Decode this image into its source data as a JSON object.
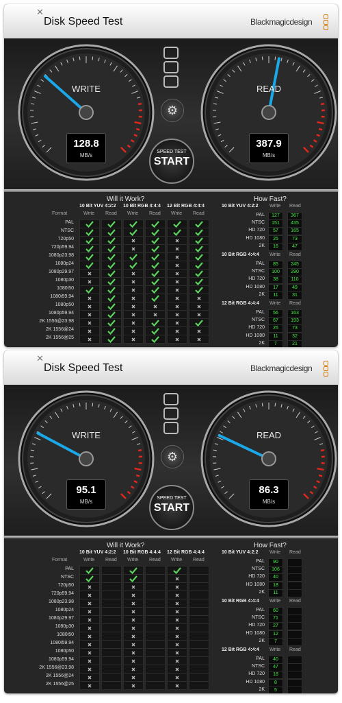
{
  "windows": [
    {
      "app_title": "Disk Speed Test",
      "brand": "Blackmagicdesign",
      "close_icon": "close-x-icon",
      "write": {
        "label": "WRITE",
        "value": "128.8",
        "unit": "MB/s",
        "needle_fraction": 0.32
      },
      "read": {
        "label": "READ",
        "value": "387.9",
        "unit": "MB/s",
        "needle_fraction": 0.54
      },
      "start": {
        "small": "SPEED TEST",
        "big": "START"
      },
      "will_title": "Will it Work?",
      "fast_title": "How Fast?",
      "groups": [
        "10 Bit YUV 4:2:2",
        "10 Bit RGB 4:4:4",
        "12 Bit RGB 4:4:4"
      ],
      "col_write": "Write",
      "col_read": "Read",
      "format_header": "Format",
      "formats": [
        "PAL",
        "NTSC",
        "720p50",
        "720p59.94",
        "1080p23.98",
        "1080p24",
        "1080p29.97",
        "1080p30",
        "1080i50",
        "1080i59.94",
        "1080p50",
        "1080p59.94",
        "2K 1556@23.98",
        "2K 1556@24",
        "2K 1556@25"
      ],
      "grid": [
        [
          "ok",
          "ok",
          "ok",
          "ok",
          "ok",
          "ok"
        ],
        [
          "ok",
          "ok",
          "ok",
          "ok",
          "ok",
          "ok"
        ],
        [
          "ok",
          "ok",
          "x",
          "ok",
          "x",
          "ok"
        ],
        [
          "ok",
          "ok",
          "x",
          "ok",
          "x",
          "ok"
        ],
        [
          "ok",
          "ok",
          "ok",
          "ok",
          "x",
          "ok"
        ],
        [
          "ok",
          "ok",
          "ok",
          "ok",
          "x",
          "ok"
        ],
        [
          "x",
          "ok",
          "x",
          "ok",
          "x",
          "ok"
        ],
        [
          "x",
          "ok",
          "x",
          "ok",
          "x",
          "ok"
        ],
        [
          "ok",
          "ok",
          "x",
          "ok",
          "x",
          "ok"
        ],
        [
          "x",
          "ok",
          "x",
          "ok",
          "x",
          "x"
        ],
        [
          "x",
          "ok",
          "x",
          "x",
          "x",
          "x"
        ],
        [
          "x",
          "ok",
          "x",
          "x",
          "x",
          "x"
        ],
        [
          "x",
          "ok",
          "x",
          "ok",
          "x",
          "ok"
        ],
        [
          "x",
          "ok",
          "x",
          "ok",
          "x",
          "x"
        ],
        [
          "x",
          "ok",
          "x",
          "ok",
          "x",
          "x"
        ]
      ],
      "fast": [
        {
          "name": "10 Bit YUV 4:2:2",
          "rows": [
            [
              "PAL",
              "127",
              "367"
            ],
            [
              "NTSC",
              "151",
              "435"
            ],
            [
              "HD 720",
              "57",
              "165"
            ],
            [
              "HD 1080",
              "25",
              "73"
            ],
            [
              "2K",
              "16",
              "47"
            ]
          ]
        },
        {
          "name": "10 Bit RGB 4:4:4",
          "rows": [
            [
              "PAL",
              "85",
              "245"
            ],
            [
              "NTSC",
              "100",
              "290"
            ],
            [
              "HD 720",
              "38",
              "110"
            ],
            [
              "HD 1080",
              "17",
              "49"
            ],
            [
              "2K",
              "11",
              "31"
            ]
          ]
        },
        {
          "name": "12 Bit RGB 4:4:4",
          "rows": [
            [
              "PAL",
              "56",
              "163"
            ],
            [
              "NTSC",
              "67",
              "193"
            ],
            [
              "HD 720",
              "25",
              "73"
            ],
            [
              "HD 1080",
              "11",
              "32"
            ],
            [
              "2K",
              "7",
              "21"
            ]
          ]
        }
      ]
    },
    {
      "app_title": "Disk Speed Test",
      "brand": "Blackmagicdesign",
      "close_icon": "close-x-icon",
      "write": {
        "label": "WRITE",
        "value": "95.1",
        "unit": "MB/s",
        "needle_fraction": 0.27
      },
      "read": {
        "label": "READ",
        "value": "86.3",
        "unit": "MB/s",
        "needle_fraction": 0.26
      },
      "start": {
        "small": "SPEED TEST",
        "big": "START"
      },
      "will_title": "Will it Work?",
      "fast_title": "How Fast?",
      "groups": [
        "10 Bit YUV 4:2:2",
        "10 Bit RGB 4:4:4",
        "12 Bit RGB 4:4:4"
      ],
      "col_write": "Write",
      "col_read": "Read",
      "format_header": "Format",
      "formats": [
        "PAL",
        "NTSC",
        "720p50",
        "720p59.94",
        "1080p23.98",
        "1080p24",
        "1080p29.97",
        "1080p30",
        "1080i50",
        "1080i59.94",
        "1080p50",
        "1080p59.94",
        "2K 1556@23.98",
        "2K 1556@24",
        "2K 1556@25"
      ],
      "grid": [
        [
          "ok",
          "",
          "ok",
          "",
          "ok",
          ""
        ],
        [
          "ok",
          "",
          "ok",
          "",
          "x",
          ""
        ],
        [
          "x",
          "",
          "x",
          "",
          "x",
          ""
        ],
        [
          "x",
          "",
          "x",
          "",
          "x",
          ""
        ],
        [
          "x",
          "",
          "x",
          "",
          "x",
          ""
        ],
        [
          "x",
          "",
          "x",
          "",
          "x",
          ""
        ],
        [
          "x",
          "",
          "x",
          "",
          "x",
          ""
        ],
        [
          "x",
          "",
          "x",
          "",
          "x",
          ""
        ],
        [
          "x",
          "",
          "x",
          "",
          "x",
          ""
        ],
        [
          "x",
          "",
          "x",
          "",
          "x",
          ""
        ],
        [
          "x",
          "",
          "x",
          "",
          "x",
          ""
        ],
        [
          "x",
          "",
          "x",
          "",
          "x",
          ""
        ],
        [
          "x",
          "",
          "x",
          "",
          "x",
          ""
        ],
        [
          "x",
          "",
          "x",
          "",
          "x",
          ""
        ],
        [
          "x",
          "",
          "x",
          "",
          "x",
          ""
        ]
      ],
      "fast": [
        {
          "name": "10 Bit YUV 4:2:2",
          "rows": [
            [
              "PAL",
              "90",
              ""
            ],
            [
              "NTSC",
              "106",
              ""
            ],
            [
              "HD 720",
              "40",
              ""
            ],
            [
              "HD 1080",
              "18",
              ""
            ],
            [
              "2K",
              "11",
              ""
            ]
          ]
        },
        {
          "name": "10 Bit RGB 4:4:4",
          "rows": [
            [
              "PAL",
              "60",
              ""
            ],
            [
              "NTSC",
              "71",
              ""
            ],
            [
              "HD 720",
              "27",
              ""
            ],
            [
              "HD 1080",
              "12",
              ""
            ],
            [
              "2K",
              "7",
              ""
            ]
          ]
        },
        {
          "name": "12 Bit RGB 4:4:4",
          "rows": [
            [
              "PAL",
              "40",
              ""
            ],
            [
              "NTSC",
              "47",
              ""
            ],
            [
              "HD 720",
              "18",
              ""
            ],
            [
              "HD 1080",
              "8",
              ""
            ],
            [
              "2K",
              "5",
              ""
            ]
          ]
        }
      ]
    }
  ],
  "colors": {
    "needle": "#1aa8e8",
    "redline": "#e0281c",
    "check": "#5cd35c",
    "fast_value": "#44ee44",
    "brand_logo": "#d07a10"
  }
}
